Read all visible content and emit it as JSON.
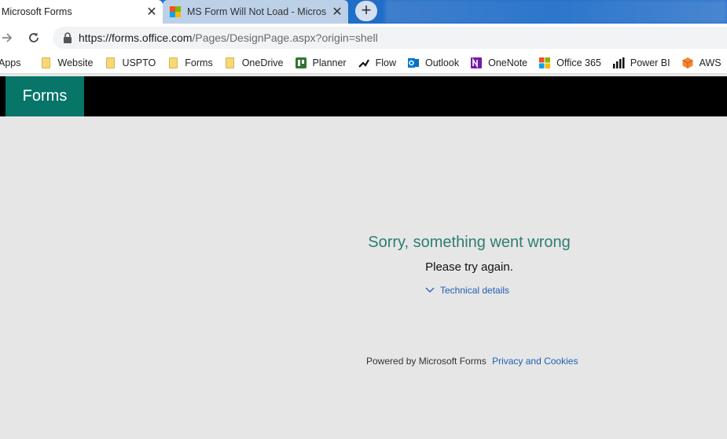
{
  "tabs": {
    "active_title": "Microsoft Forms",
    "inactive_title": "MS Form Will Not Load - Microsoft",
    "close_glyph": "✕",
    "new_tab_glyph": "+"
  },
  "address_bar": {
    "url_host": "https://forms.office.com",
    "url_path": "/Pages/DesignPage.aspx?origin=shell"
  },
  "bookmarks": [
    {
      "label": "Apps",
      "icon": "apps-grid-icon"
    },
    {
      "label": "Website",
      "icon": "folder-icon"
    },
    {
      "label": "USPTO",
      "icon": "folder-icon"
    },
    {
      "label": "Forms",
      "icon": "folder-icon"
    },
    {
      "label": "OneDrive",
      "icon": "folder-icon"
    },
    {
      "label": "Planner",
      "icon": "planner-icon"
    },
    {
      "label": "Flow",
      "icon": "flow-icon"
    },
    {
      "label": "Outlook",
      "icon": "outlook-icon"
    },
    {
      "label": "OneNote",
      "icon": "onenote-icon"
    },
    {
      "label": "Office 365",
      "icon": "office-icon"
    },
    {
      "label": "Power BI",
      "icon": "powerbi-icon"
    },
    {
      "label": "AWS",
      "icon": "aws-icon"
    }
  ],
  "app": {
    "brand": "Forms",
    "brand_color": "#077568"
  },
  "error": {
    "title": "Sorry, something went wrong",
    "subtitle": "Please try again.",
    "details_link": "Technical details"
  },
  "footer": {
    "powered_by": "Powered by Microsoft Forms",
    "privacy_link": "Privacy and Cookies"
  }
}
